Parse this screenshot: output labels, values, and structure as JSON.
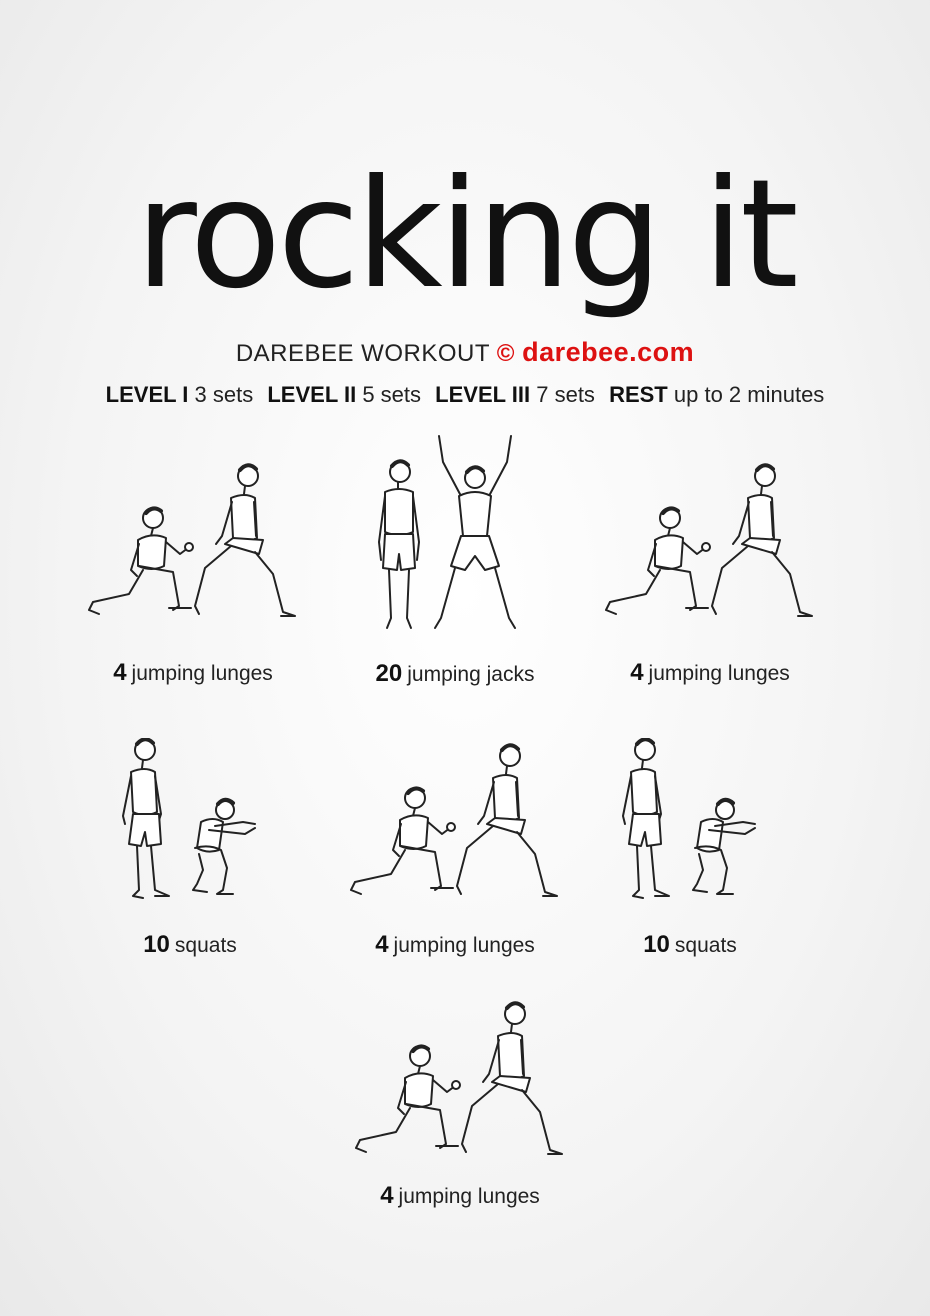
{
  "title": "rocking it",
  "brand": {
    "prefix": "DAREBEE WORKOUT",
    "copyright": "©",
    "site": "darebee.com"
  },
  "levels": [
    {
      "name": "LEVEL I",
      "value": "3 sets"
    },
    {
      "name": "LEVEL II",
      "value": "5 sets"
    },
    {
      "name": "LEVEL III",
      "value": "7 sets"
    },
    {
      "name": "REST",
      "value": "up to 2 minutes"
    }
  ],
  "exercises": [
    {
      "count": "4",
      "name": "jumping lunges",
      "figure": "jumping-lunges-illustration"
    },
    {
      "count": "20",
      "name": "jumping jacks",
      "figure": "jumping-jacks-illustration"
    },
    {
      "count": "4",
      "name": "jumping lunges",
      "figure": "jumping-lunges-illustration"
    },
    {
      "count": "10",
      "name": "squats",
      "figure": "squats-illustration"
    },
    {
      "count": "4",
      "name": "jumping lunges",
      "figure": "jumping-lunges-illustration"
    },
    {
      "count": "10",
      "name": "squats",
      "figure": "squats-illustration"
    },
    {
      "count": "4",
      "name": "jumping lunges",
      "figure": "jumping-lunges-illustration"
    }
  ]
}
